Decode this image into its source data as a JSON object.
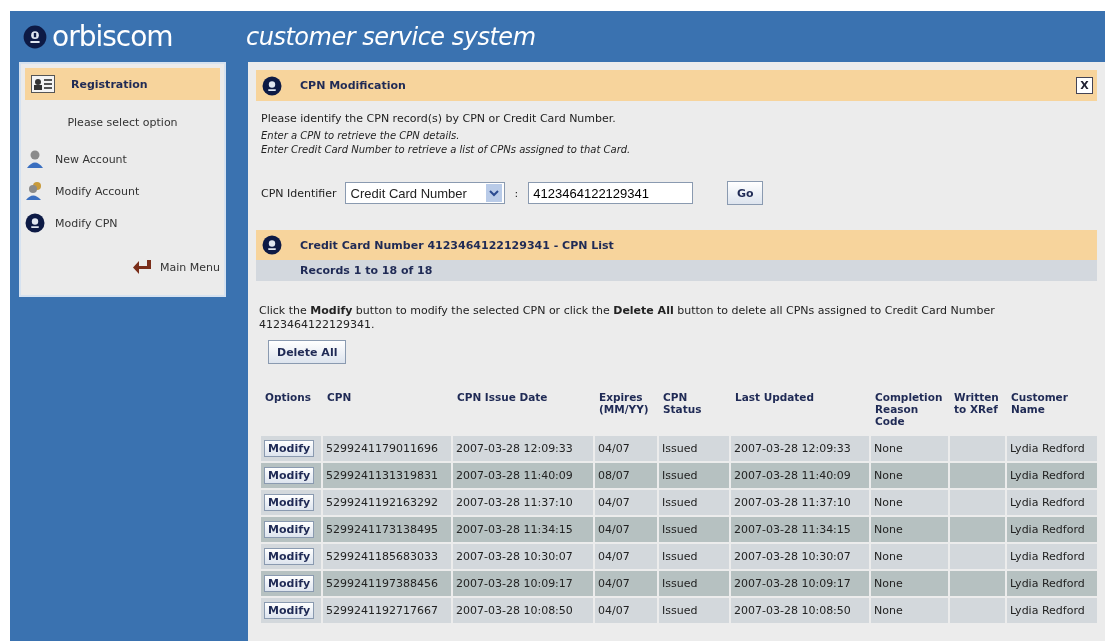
{
  "header": {
    "logo": "orbiscom",
    "title": "customer service system"
  },
  "sidebar": {
    "heading": "Registration",
    "prompt": "Please select option",
    "items": [
      {
        "label": "New Account",
        "kind": "person"
      },
      {
        "label": "Modify Account",
        "kind": "people"
      },
      {
        "label": "Modify CPN",
        "kind": "orb"
      }
    ],
    "main_menu": "Main Menu"
  },
  "panel": {
    "title": "CPN Modification",
    "close": "X",
    "intro": "Please identify the CPN record(s) by CPN or Credit Card Number.",
    "hints": [
      "Enter a CPN to retrieve the CPN details.",
      "Enter Credit Card Number to retrieve a list of CPNs assigned to that Card."
    ],
    "identifier_label": "CPN Identifier",
    "identifier_type": "Credit Card Number",
    "separator": ":",
    "identifier_value": "4123464122129341",
    "go": "Go"
  },
  "list": {
    "title": "Credit Card Number 4123464122129341 - CPN List",
    "records": "Records 1 to 18 of 18",
    "instructions": "Click the **Modify** button to modify the selected CPN or click the **Delete All** button to delete all CPNs assigned to Credit Card Number 4123464122129341.",
    "delete_all": "Delete All"
  },
  "table": {
    "columns": [
      "Options",
      "CPN",
      "CPN Issue Date",
      "Expires (MM/YY)",
      "CPN Status",
      "Last Updated",
      "Completion Reason Code",
      "Written to XRef",
      "Customer Name"
    ],
    "rows": [
      {
        "cells": [
          "Modify",
          "5299241179011696",
          "2007-03-28 12:09:33",
          "04/07",
          "Issued",
          "2007-03-28 12:09:33",
          "None",
          "",
          "Lydia Redford"
        ]
      },
      {
        "cells": [
          "Modify",
          "5299241131319831",
          "2007-03-28 11:40:09",
          "08/07",
          "Issued",
          "2007-03-28 11:40:09",
          "None",
          "",
          "Lydia Redford"
        ]
      },
      {
        "cells": [
          "Modify",
          "5299241192163292",
          "2007-03-28 11:37:10",
          "04/07",
          "Issued",
          "2007-03-28 11:37:10",
          "None",
          "",
          "Lydia Redford"
        ]
      },
      {
        "cells": [
          "Modify",
          "5299241173138495",
          "2007-03-28 11:34:15",
          "04/07",
          "Issued",
          "2007-03-28 11:34:15",
          "None",
          "",
          "Lydia Redford"
        ]
      },
      {
        "cells": [
          "Modify",
          "5299241185683033",
          "2007-03-28 10:30:07",
          "04/07",
          "Issued",
          "2007-03-28 10:30:07",
          "None",
          "",
          "Lydia Redford"
        ]
      },
      {
        "cells": [
          "Modify",
          "5299241197388456",
          "2007-03-28 10:09:17",
          "04/07",
          "Issued",
          "2007-03-28 10:09:17",
          "None",
          "",
          "Lydia Redford"
        ]
      },
      {
        "cells": [
          "Modify",
          "5299241192717667",
          "2007-03-28 10:08:50",
          "04/07",
          "Issued",
          "2007-03-28 10:08:50",
          "None",
          "",
          "Lydia Redford"
        ]
      }
    ]
  }
}
